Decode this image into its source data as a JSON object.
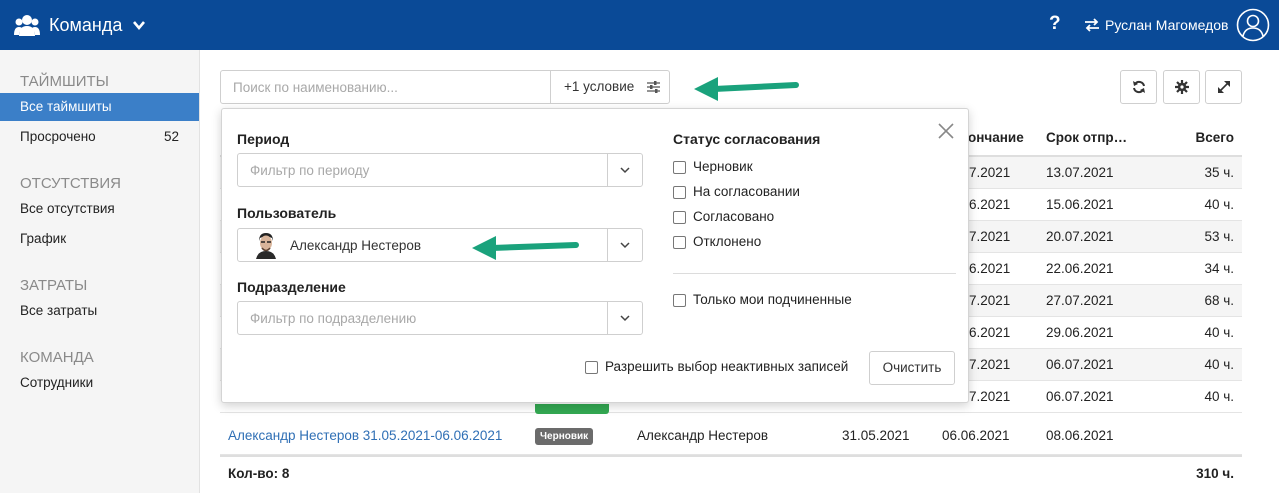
{
  "topbar": {
    "title": "Команда",
    "help": "?",
    "user_name": "Руслан Магомедов",
    "bg_color": "#0a4a97"
  },
  "sidebar": {
    "sections": [
      {
        "title": "ТАЙМШИТЫ",
        "items": [
          {
            "label": "Все таймшиты",
            "active": true
          },
          {
            "label": "Просрочено",
            "count": "52"
          }
        ]
      },
      {
        "title": "ОТСУТСТВИЯ",
        "items": [
          {
            "label": "Все отсутствия"
          },
          {
            "label": "График"
          }
        ]
      },
      {
        "title": "ЗАТРАТЫ",
        "items": [
          {
            "label": "Все затраты"
          }
        ]
      },
      {
        "title": "КОМАНДА",
        "items": [
          {
            "label": "Сотрудники"
          }
        ]
      }
    ],
    "active_color": "#3b7fc8"
  },
  "toolbar": {
    "search_placeholder": "Поиск по наименованию...",
    "condition_label": "+1 условие"
  },
  "table": {
    "headers": {
      "end": "ончание",
      "deadline": "Срок отпр…",
      "total": "Всего"
    },
    "rows": [
      {
        "end": "7.2021",
        "deadline": "13.07.2021",
        "total": "35 ч."
      },
      {
        "end": "6.2021",
        "deadline": "15.06.2021",
        "total": "40 ч."
      },
      {
        "end": "7.2021",
        "deadline": "20.07.2021",
        "total": "53 ч."
      },
      {
        "end": "6.2021",
        "deadline": "22.06.2021",
        "total": "34 ч."
      },
      {
        "end": "7.2021",
        "deadline": "27.07.2021",
        "total": "68 ч."
      },
      {
        "end": "6.2021",
        "deadline": "29.06.2021",
        "total": "40 ч."
      },
      {
        "end": "7.2021",
        "deadline": "06.07.2021",
        "total": "40 ч."
      },
      {
        "name": "Александр Нестеров 31.05.2021-06.06.2021",
        "status": "Черновик",
        "user": "Александр Нестеров",
        "start": "31.05.2021",
        "end": "06.06.2021",
        "deadline": "08.06.2021",
        "total": ""
      }
    ],
    "footer": {
      "count": "Кол-во: 8",
      "total": "310 ч."
    }
  },
  "filter": {
    "period_label": "Период",
    "period_placeholder": "Фильтр по периоду",
    "user_label": "Пользователь",
    "user_value": "Александр Нестеров",
    "dept_label": "Подразделение",
    "dept_placeholder": "Фильтр по подразделению",
    "status_label": "Статус согласования",
    "statuses": [
      "Черновик",
      "На согласовании",
      "Согласовано",
      "Отклонено"
    ],
    "only_subordinates": "Только мои подчиненные",
    "allow_inactive": "Разрешить выбор неактивных записей",
    "clear": "Очистить"
  },
  "annotation_color": "#1aa27c"
}
